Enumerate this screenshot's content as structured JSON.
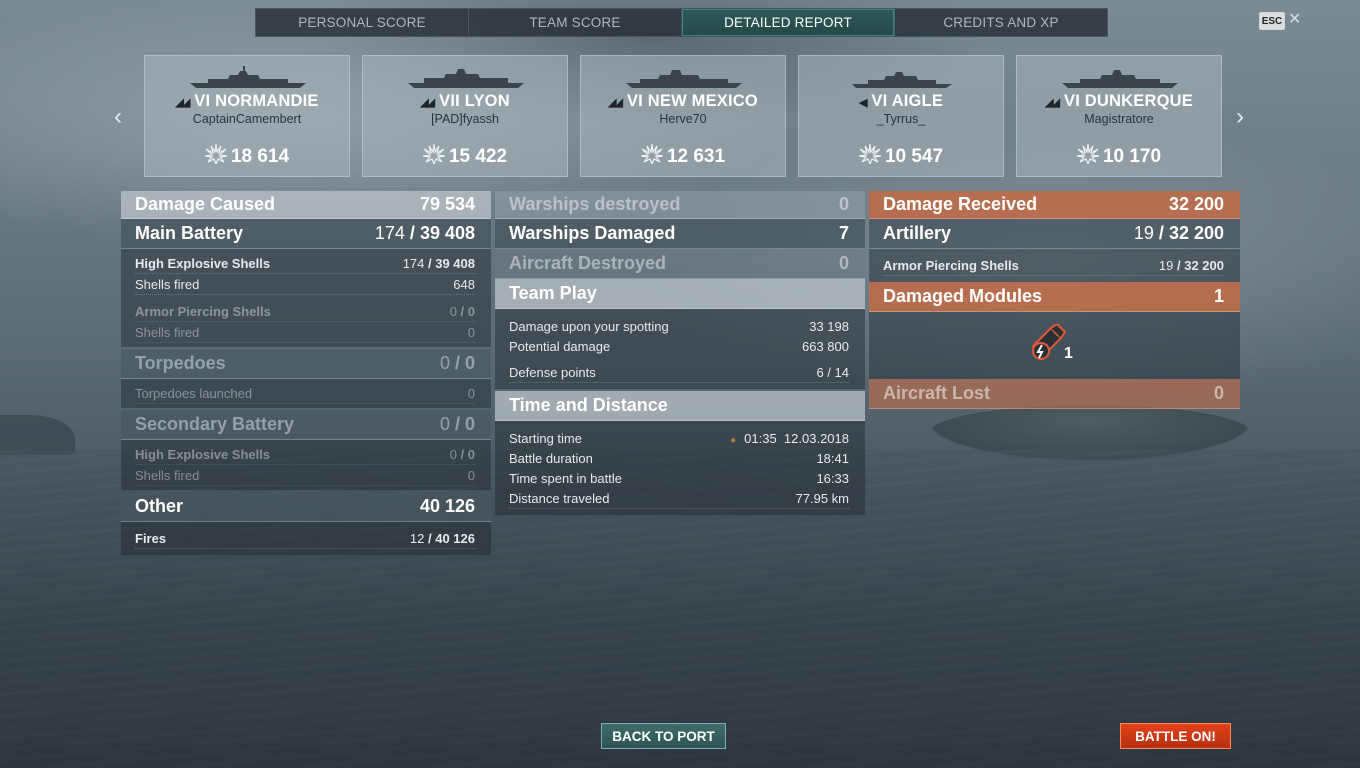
{
  "tabs": [
    "PERSONAL SCORE",
    "TEAM SCORE",
    "DETAILED REPORT",
    "CREDITS AND XP"
  ],
  "esc_label": "ESC",
  "close_glyph": "✕",
  "nav": {
    "prev": "‹",
    "next": "›"
  },
  "ships": [
    {
      "tier": "VI",
      "name": "NORMANDIE",
      "player": "CaptainCamembert",
      "score": "18 614",
      "class_icon": "battleship-icon"
    },
    {
      "tier": "VII",
      "name": "LYON",
      "player": "[PAD]fyassh",
      "score": "15 422",
      "class_icon": "battleship-icon"
    },
    {
      "tier": "VI",
      "name": "NEW MEXICO",
      "player": "Herve70",
      "score": "12 631",
      "class_icon": "battleship-icon"
    },
    {
      "tier": "VI",
      "name": "AIGLE",
      "player": "_Tyrrus_",
      "score": "10 547",
      "class_icon": "destroyer-icon"
    },
    {
      "tier": "VI",
      "name": "DUNKERQUE",
      "player": "Magistratore",
      "score": "10 170",
      "class_icon": "battleship-icon"
    }
  ],
  "damage_caused": {
    "title": "Damage Caused",
    "value": "79 534",
    "main_battery": {
      "title": "Main Battery",
      "hits": "174",
      "damage": "39 408"
    },
    "he": {
      "label": "High Explosive Shells",
      "hits": "174",
      "damage": "39 408",
      "fired_label": "Shells fired",
      "fired": "648"
    },
    "ap": {
      "label": "Armor Piercing Shells",
      "hits": "0",
      "damage": "0",
      "fired_label": "Shells fired",
      "fired": "0"
    },
    "torpedoes": {
      "title": "Torpedoes",
      "hits": "0",
      "damage": "0",
      "launched_label": "Torpedoes launched",
      "launched": "0"
    },
    "secondary": {
      "title": "Secondary Battery",
      "he_label": "High Explosive Shells",
      "hits": "0",
      "damage": "0",
      "fired_label": "Shells fired",
      "fired": "0"
    },
    "other": {
      "title": "Other",
      "value": "40 126",
      "fires_label": "Fires",
      "fires_hits": "12",
      "fires_damage": "40 126"
    }
  },
  "middle": {
    "warships_destroyed": {
      "label": "Warships destroyed",
      "value": "0"
    },
    "warships_damaged": {
      "label": "Warships Damaged",
      "value": "7"
    },
    "aircraft_destroyed": {
      "label": "Aircraft Destroyed",
      "value": "0"
    },
    "team_play": {
      "title": "Team Play",
      "spotting_label": "Damage upon your spotting",
      "spotting": "33 198",
      "potential_label": "Potential damage",
      "potential": "663 800",
      "defense_label": "Defense points",
      "defense_a": "6",
      "defense_b": "14"
    },
    "time_distance": {
      "title": "Time and Distance",
      "start_label": "Starting time",
      "start_time": "01:35",
      "start_date": "12.03.2018",
      "duration_label": "Battle duration",
      "duration": "18:41",
      "spent_label": "Time spent in battle",
      "spent": "16:33",
      "distance_label": "Distance traveled",
      "distance": "77.95 km"
    }
  },
  "received": {
    "title": "Damage Received",
    "value": "32 200",
    "artillery": {
      "title": "Artillery",
      "hits": "19",
      "damage": "32 200"
    },
    "ap": {
      "label": "Armor Piercing Shells",
      "hits": "19",
      "damage": "32 200"
    },
    "modules": {
      "title": "Damaged Modules",
      "value": "1",
      "icon": "damaged-torpedo-module-icon",
      "count": "1"
    },
    "aircraft_lost": {
      "title": "Aircraft Lost",
      "value": "0"
    }
  },
  "buttons": {
    "back": "BACK TO PORT",
    "battle": "BATTLE ON!"
  },
  "colors": {
    "accent_teal": "#2f5a5a",
    "orange_panel": "#c46a44",
    "battle_button": "#d43a16"
  }
}
